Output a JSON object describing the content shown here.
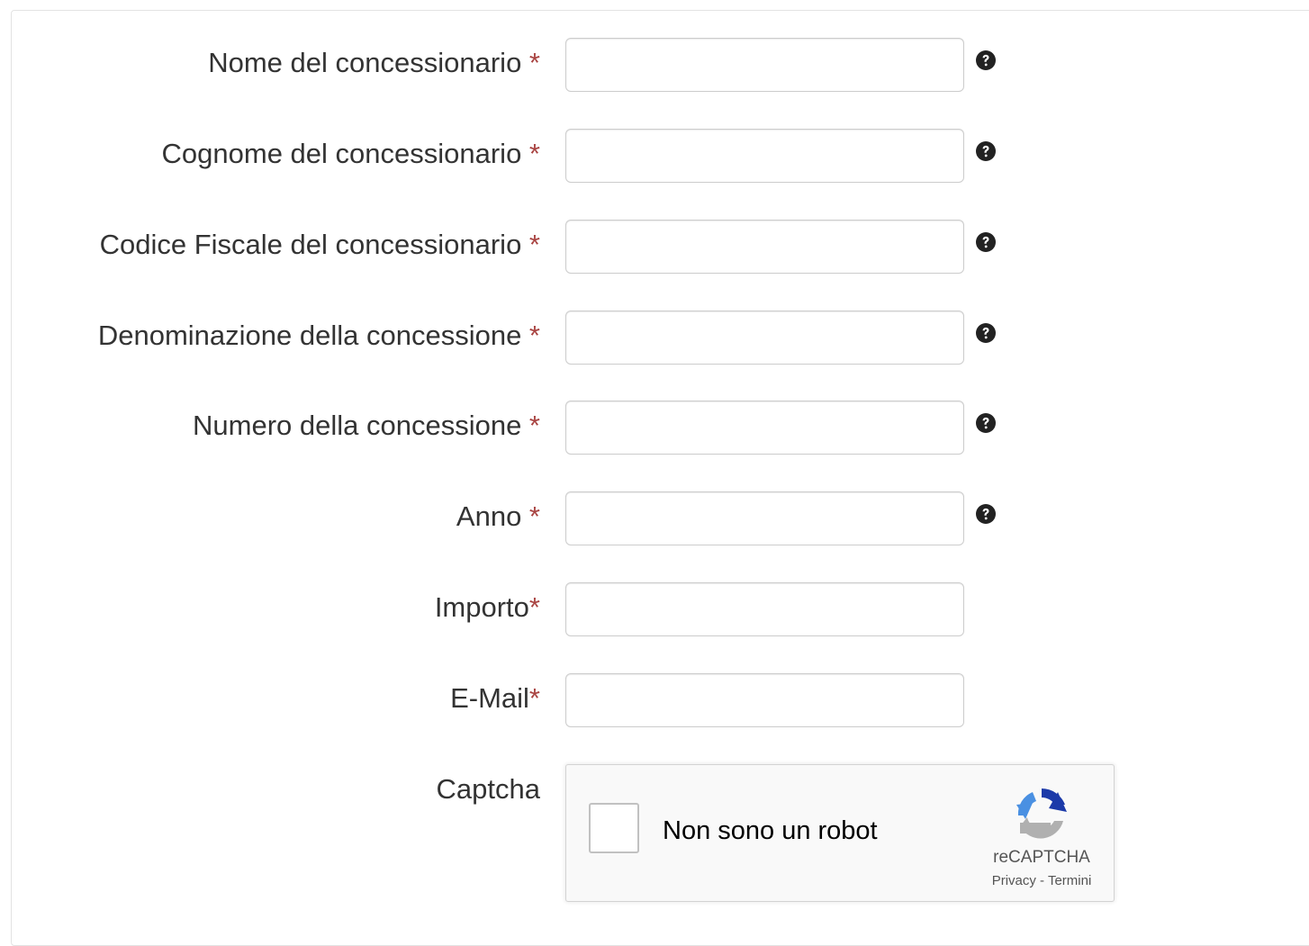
{
  "required_marker": "*",
  "fields": [
    {
      "label": "Nome del concessionario",
      "suffix": " *",
      "value": "",
      "help_icon": "question-circle-icon"
    },
    {
      "label": "Cognome del concessionario",
      "suffix": " *",
      "value": "",
      "help_icon": "question-circle-icon"
    },
    {
      "label": "Codice Fiscale del concessionario",
      "suffix": " *",
      "value": "",
      "help_icon": "question-circle-icon"
    },
    {
      "label": "Denominazione della concessione",
      "suffix": " *",
      "value": "",
      "help_icon": "question-circle-icon"
    },
    {
      "label": "Numero della concessione",
      "suffix": " *",
      "value": "",
      "help_icon": "question-circle-icon"
    },
    {
      "label": "Anno",
      "suffix": " *",
      "value": "",
      "help_icon": "question-circle-icon"
    },
    {
      "label": "Importo",
      "suffix": "*",
      "value": ""
    },
    {
      "label": "E-Mail",
      "suffix": "*",
      "value": ""
    }
  ],
  "captcha": {
    "label": "Captcha",
    "checkbox_label": "Non sono un robot",
    "checked": false,
    "brand": "reCAPTCHA",
    "privacy_link": "Privacy",
    "separator": " - ",
    "terms_link": "Termini"
  },
  "colors": {
    "required": "#a94442",
    "label_text": "#333333",
    "help_icon": "#222222",
    "recaptcha_blue": "#1c3aa9",
    "recaptcha_light_blue": "#4a90e2",
    "recaptcha_gray": "#b0b0b0"
  }
}
